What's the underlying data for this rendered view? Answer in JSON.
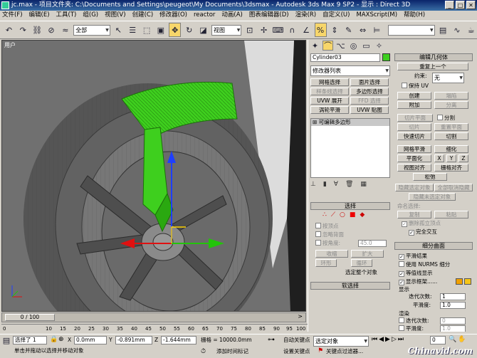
{
  "title": "jc.max  - 项目文件夹: C:\\Documents and Settings\\peugeot\\My Documents\\3dsmax  - Autodesk 3ds Max 9 SP2  - 显示 : Direct 3D",
  "menu": [
    "文件(F)",
    "编辑(E)",
    "工具(T)",
    "组(G)",
    "视图(V)",
    "创建(C)",
    "修改器(O)",
    "reactor",
    "动画(A)",
    "图表编辑器(D)",
    "渲染(R)",
    "自定义(U)",
    "MAXScript(M)",
    "帮助(H)"
  ],
  "toolbar": {
    "selection_filter": "全部",
    "coord_system": "视图"
  },
  "viewport": {
    "label": "用户"
  },
  "command_panel": {
    "object_name": "Cylinder03",
    "modifier_list": "修改器列表",
    "buttons": [
      "网格选择",
      "面片选择",
      "样条线选择",
      "多边形选择",
      "UVW 展开",
      "FFD 选择",
      "涡轮平滑",
      "UVW 贴图"
    ],
    "stack_item": "可编辑多边形",
    "select_header": "选择",
    "by_vertex": "按顶点",
    "ignore_backface": "忽略背面",
    "by_angle": "按角度:",
    "angle_value": "45.0",
    "shrink": "收缩",
    "grow": "扩大",
    "ring": "环形",
    "loop": "循环",
    "selected_count": "选定整个对象",
    "soft_select": "软选择"
  },
  "edit_geometry": {
    "header": "编辑几何体",
    "repeat_last": "重复上一个",
    "constraint_label": "约束:",
    "constraint_value": "无",
    "preserve_uv": "保持 UV",
    "create": "创建",
    "collapse": "塌陷",
    "attach": "附加",
    "detach": "分离",
    "slice_plane": "切片平面",
    "split": "分割",
    "slice": "切片",
    "reset_plane": "重置平面",
    "quick_slice": "快速切片",
    "cut": "切割",
    "msmooth": "网格平滑",
    "tessellate": "细化",
    "make_planar": "平面化",
    "x": "X",
    "y": "Y",
    "z": "Z",
    "view_align": "视图对齐",
    "grid_align": "栅格对齐",
    "relax": "松弛",
    "hide_selected": "隐藏选定对象",
    "unhide_all": "全部取消隐藏",
    "hide_unselected": "隐藏未选定对象",
    "named_sel": "命名选择:",
    "copy": "复制",
    "paste": "粘贴",
    "delete_isolated": "删除孤立顶点",
    "full_interactivity": "完全交互"
  },
  "subdivision": {
    "header": "细分曲面",
    "smooth_result": "平滑结果",
    "use_nurms": "使用 NURMS 细分",
    "isoline": "等值线显示",
    "show_cage": "显示框架......",
    "display": "显示",
    "iterations": "迭代次数:",
    "iter_value": "1",
    "smoothness": "平滑度:",
    "smooth_value": "1.0",
    "render": "渲染",
    "r_iter_value": "0",
    "r_smooth_value": "1.0"
  },
  "timeline": {
    "slider": "0 / 100",
    "ticks": [
      "0",
      "10",
      "15",
      "20",
      "25",
      "30",
      "35",
      "40",
      "45",
      "50",
      "55",
      "60",
      "65",
      "70",
      "75",
      "80",
      "85",
      "90",
      "95",
      "100"
    ]
  },
  "status": {
    "selected": "选择了 1",
    "x": "0.0mm",
    "y": "-0.891mm",
    "z": "-1.644mm",
    "grid": "栅格 = 10000.0mm",
    "auto_key": "自动关键点",
    "set_key": "设置关键点",
    "sel_set": "选定对象",
    "key_filters": "关键点过滤器...",
    "prompt": "单击并拖动以选择并移动对象",
    "add_time_tag": "添加时间标记",
    "frame": "0"
  },
  "colors": {
    "selection": "#3ecf1e",
    "viewport_bg": "#6f6f6f",
    "wheel": "#5a5a5a"
  },
  "watermark": "Chinavid.com"
}
